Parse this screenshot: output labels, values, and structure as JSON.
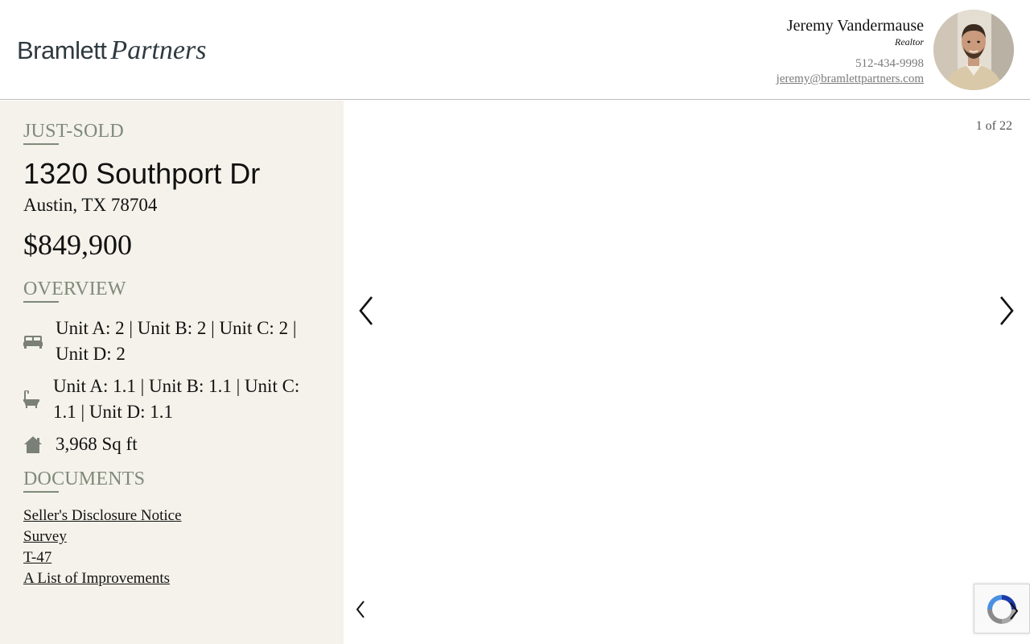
{
  "header": {
    "logo_part1": "Bramlett",
    "logo_part2": "Partners",
    "agent_name": "Jeremy Vandermause",
    "agent_title": "Realtor",
    "agent_phone": "512-434-9998",
    "agent_email": "jeremy@bramlettpartners.com"
  },
  "listing": {
    "status": "JUST-SOLD",
    "street": "1320 Southport Dr",
    "city_state_zip": "Austin, TX 78704",
    "price": "$849,900"
  },
  "overview": {
    "heading": "OVERVIEW",
    "bedrooms_line1": "Unit A: 2 | Unit B: 2 | Unit C: 2 |",
    "bedrooms_line2": "Unit D: 2",
    "bathrooms_line1": "Unit A: 1.1 | Unit B: 1.1 | Unit C:",
    "bathrooms_line2": "1.1 | Unit D: 1.1",
    "sqft": "3,968 Sq ft"
  },
  "documents": {
    "heading": "DOCUMENTS",
    "items": [
      "Seller's Disclosure Notice",
      "Survey",
      "T-47",
      "A List of Improvements"
    ]
  },
  "gallery": {
    "counter": "1 of 22"
  },
  "icons": {
    "bed": "bed-icon",
    "bath": "bathtub-icon",
    "home": "home-icon",
    "prev": "chevron-left-icon",
    "next": "chevron-right-icon"
  },
  "colors": {
    "sidebar_bg": "#f4f2ea",
    "accent_sage": "#7f8a7a",
    "icon_gray": "#7a8078"
  }
}
